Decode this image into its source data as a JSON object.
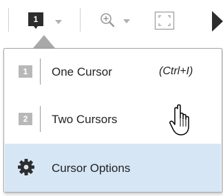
{
  "toolbar": {
    "cursor_button_glyph": "1",
    "items": [
      {
        "name": "cursor-mode-dropdown",
        "icon": "cursor-icon"
      },
      {
        "name": "zoom-dropdown",
        "icon": "zoom-in-icon"
      },
      {
        "name": "fit-to-view",
        "icon": "fit-to-view-icon"
      },
      {
        "name": "play",
        "icon": "play-icon"
      }
    ]
  },
  "menu": {
    "items": [
      {
        "badge": "1",
        "label": "One Cursor",
        "shortcut": "(Ctrl+I)"
      },
      {
        "badge": "2",
        "label": "Two Cursors"
      },
      {
        "icon": "gear-icon",
        "label": "Cursor Options",
        "highlighted": true
      }
    ]
  },
  "colors": {
    "highlight": "#d6e6f4",
    "menu_border": "#a9a9a9",
    "badge_gray": "#b8b8b8",
    "icon_dark": "#2d2d2d"
  }
}
